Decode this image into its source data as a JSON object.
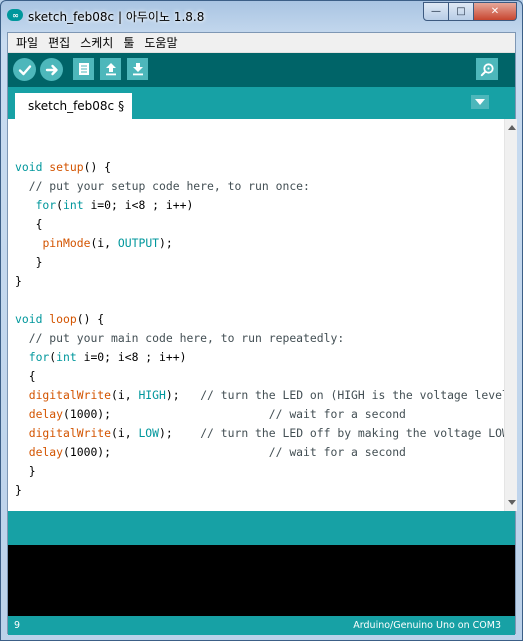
{
  "window": {
    "title": "sketch_feb08c | 아두이노 1.8.8",
    "controls": {
      "minimize": "—",
      "maximize": "□",
      "close": "✕"
    }
  },
  "menu": [
    "파일",
    "편집",
    "스케치",
    "툴",
    "도움말"
  ],
  "toolbar": {
    "buttons": [
      "verify-icon",
      "upload-icon",
      "new-icon",
      "open-icon",
      "save-icon"
    ],
    "serial_monitor": "magnifier-icon"
  },
  "tab": {
    "label": "sketch_feb08c",
    "modified_marker": "§"
  },
  "code": [
    "",
    "void setup() {",
    "  // put your setup code here, to run once:",
    "   for(int i=0; i<8 ; i++)",
    "   {",
    "    pinMode(i, OUTPUT);",
    "   }",
    "}",
    "",
    "void loop() {",
    "  // put your main code here, to run repeatedly:",
    "  for(int i=0; i<8 ; i++)",
    "  {",
    "  digitalWrite(i, HIGH);   // turn the LED on (HIGH is the voltage level)",
    "  delay(1000);                       // wait for a second",
    "  digitalWrite(i, LOW);    // turn the LED off by making the voltage LOW",
    "  delay(1000);                       // wait for a second",
    "  }",
    "}"
  ],
  "status": {
    "line": "9",
    "board": "Arduino/Genuino Uno on COM3"
  },
  "colors": {
    "toolbar": "#006468",
    "accent": "#17a1a5",
    "button": "#4db7bb",
    "keyword": "#00979c",
    "function": "#d35400"
  }
}
